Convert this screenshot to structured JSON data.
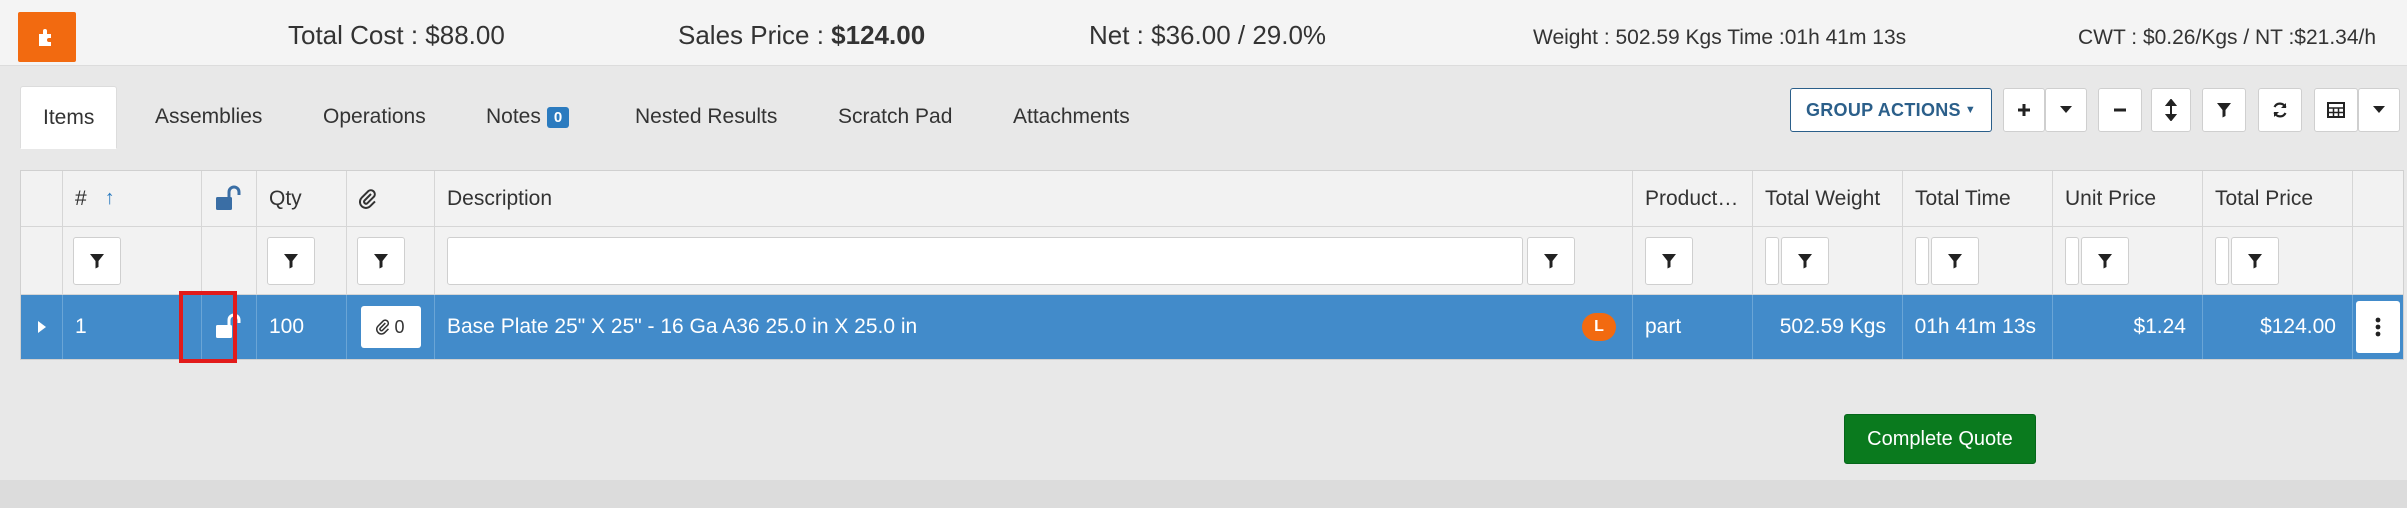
{
  "summary": {
    "total_cost": "Total Cost : $88.00",
    "sales_price_label": "Sales Price : ",
    "sales_price_value": "$124.00",
    "net": "Net : $36.00 / 29.0%",
    "weight_time": "Weight : 502.59 Kgs Time :01h 41m 13s",
    "cwt": "CWT : $0.26/Kgs / NT :$21.34/h"
  },
  "tabs": [
    {
      "label": "Items",
      "active": true
    },
    {
      "label": "Assemblies"
    },
    {
      "label": "Operations"
    },
    {
      "label": "Notes",
      "badge": "0"
    },
    {
      "label": "Nested Results"
    },
    {
      "label": "Scratch Pad"
    },
    {
      "label": "Attachments"
    }
  ],
  "toolbar": {
    "group_actions": "GROUP ACTIONS"
  },
  "grid": {
    "headers": {
      "num": "#",
      "qty": "Qty",
      "description": "Description",
      "product": "Product…",
      "total_weight": "Total Weight",
      "total_time": "Total Time",
      "unit_price": "Unit Price",
      "total_price": "Total Price"
    },
    "row": {
      "num": "1",
      "qty": "100",
      "attachments": "0",
      "description": "Base Plate 25\" X 25\" - 16 Ga A36 25.0 in X 25.0 in",
      "badge": "L",
      "product": "part",
      "total_weight": "502.59 Kgs",
      "total_time": "01h 41m 13s",
      "unit_price": "$1.24",
      "total_price": "$124.00"
    }
  },
  "complete_quote": "Complete Quote",
  "colors": {
    "accent": "#f26a10",
    "row_selected": "#428bca",
    "primary_green": "#0a7a1e",
    "badge_blue": "#2b7bbf",
    "highlight_red": "#e21b1b"
  }
}
